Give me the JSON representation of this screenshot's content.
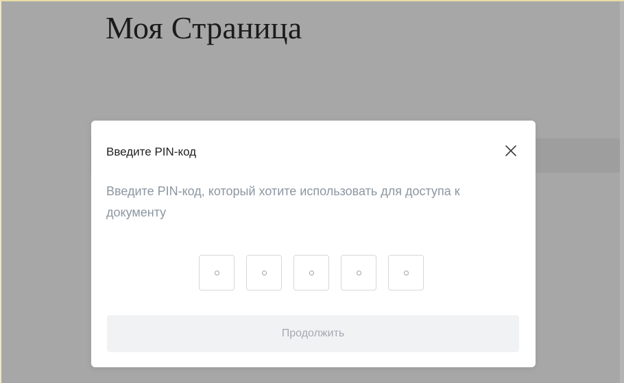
{
  "page": {
    "title": "Моя Страница"
  },
  "modal": {
    "title": "Введите PIN-код",
    "description": "Введите PIN-код, который хотите использовать для доступа к документу",
    "close_icon": "close-icon",
    "pin": {
      "length": 5,
      "values": [
        "",
        "",
        "",
        "",
        ""
      ]
    },
    "continue_label": "Продолжить",
    "continue_enabled": false
  },
  "colors": {
    "overlay": "#a7a7a7",
    "modal_bg": "#ffffff",
    "description_text": "#8c96a1",
    "button_disabled_bg": "#f1f2f4",
    "button_disabled_text": "#a4a9b0"
  }
}
